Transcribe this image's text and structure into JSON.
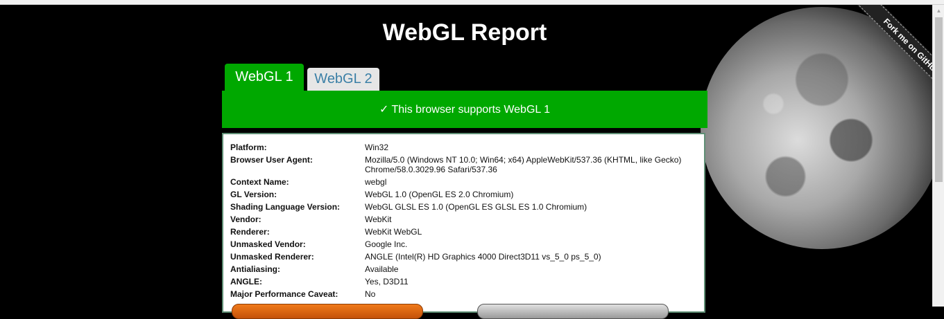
{
  "page": {
    "title": "WebGL Report",
    "ribbon_text": "Fork me on GitHub"
  },
  "tabs": [
    {
      "label": "WebGL 1",
      "active": true
    },
    {
      "label": "WebGL 2",
      "active": false
    }
  ],
  "support_message": "✓ This browser supports WebGL 1",
  "report": [
    {
      "label": "Platform:",
      "value": "Win32"
    },
    {
      "label": "Browser User Agent:",
      "value": "Mozilla/5.0 (Windows NT 10.0; Win64; x64) AppleWebKit/537.36 (KHTML, like Gecko) Chrome/58.0.3029.96 Safari/537.36"
    },
    {
      "label": "Context Name:",
      "value": "webgl"
    },
    {
      "label": "GL Version:",
      "value": "WebGL 1.0 (OpenGL ES 2.0 Chromium)"
    },
    {
      "label": "Shading Language Version:",
      "value": "WebGL GLSL ES 1.0 (OpenGL ES GLSL ES 1.0 Chromium)"
    },
    {
      "label": "Vendor:",
      "value": "WebKit"
    },
    {
      "label": "Renderer:",
      "value": "WebKit WebGL"
    },
    {
      "label": "Unmasked Vendor:",
      "value": "Google Inc."
    },
    {
      "label": "Unmasked Renderer:",
      "value": "ANGLE (Intel(R) HD Graphics 4000 Direct3D11 vs_5_0 ps_5_0)"
    },
    {
      "label": "Antialiasing:",
      "value": "Available"
    },
    {
      "label": "ANGLE:",
      "value": "Yes, D3D11"
    },
    {
      "label": "Major Performance Caveat:",
      "value": "No"
    }
  ],
  "colors": {
    "accent_green": "#00a800",
    "tab_inactive_text": "#3a7fa6"
  }
}
